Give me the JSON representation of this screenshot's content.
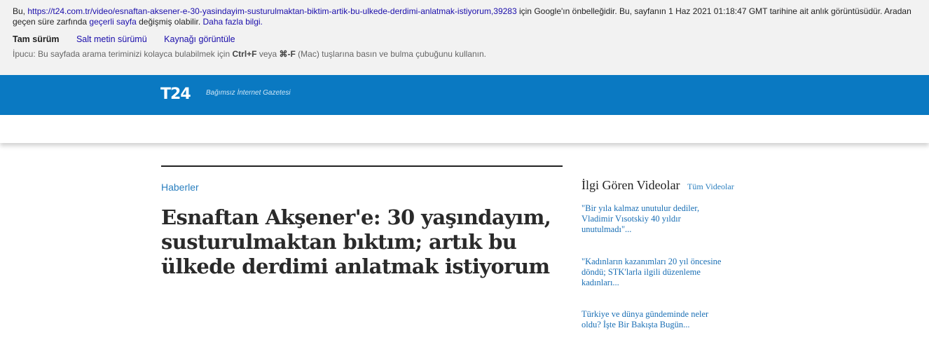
{
  "cache": {
    "prefix": "Bu, ",
    "url": "https://t24.com.tr/video/esnaftan-aksener-e-30-yasindayim-susturulmaktan-biktim-artik-bu-ulkede-derdimi-anlatmak-istiyorum,39283",
    "middle": " için Google'ın önbelleğidir. Bu, sayfanın 1 Haz 2021 01:18:47 GMT tarihine ait anlık görüntüsüdür. Aradan geçen süre zarfında ",
    "current_page_link": "geçerli sayfa",
    "changed_text": " değişmiş olabilir. ",
    "more_info_link": "Daha fazla bilgi.",
    "tab_full": "Tam sürüm",
    "tab_text": "Salt metin sürümü",
    "tab_source": "Kaynağı görüntüle",
    "tip_prefix": "İpucu: Bu sayfada arama teriminizi kolayca bulabilmek için ",
    "tip_key1": "Ctrl+F",
    "tip_or": " veya ",
    "tip_key2": "⌘-F",
    "tip_suffix": " (Mac) tuşlarına basın ve bulma çubuğunu kullanın."
  },
  "site": {
    "logo": "T24",
    "tagline": "Bağımsız İnternet Gazetesi"
  },
  "article": {
    "category": "Haberler",
    "headline": "Esnaftan Akşener'e: 30 yaşındayım, susturulmaktan bıktım; artık bu ülkede derdimi anlatmak istiyorum"
  },
  "sidebar": {
    "title": "İlgi Gören Videolar",
    "all_link": "Tüm Videolar",
    "items": [
      {
        "text": "\"Bir yıla kalmaz unutulur dediler, Vladimir Vısotskiy 40 yıldır unutulmadı\"..."
      },
      {
        "text": "\"Kadınların kazanımları 20 yıl öncesine döndü; STK'larla ilgili düzenleme kadınları..."
      },
      {
        "text": "Türkiye ve dünya gündeminde neler oldu? İşte Bir Bakışta Bugün..."
      }
    ]
  },
  "colors": {
    "brand_blue": "#0a79c2",
    "link": "#1a0dab",
    "accent_link": "#2a7fbf"
  }
}
